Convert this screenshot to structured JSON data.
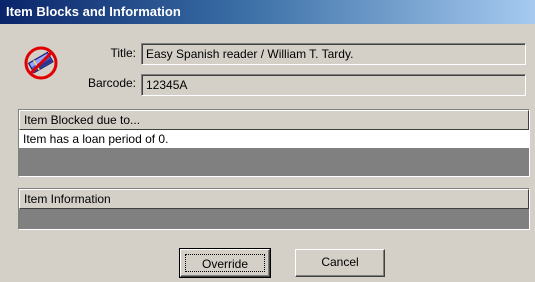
{
  "window": {
    "title": "Item Blocks and Information"
  },
  "icon": {
    "name": "item-blocked-icon"
  },
  "fields": {
    "title_label": "Title:",
    "title_value": "Easy Spanish reader / William T. Tardy.",
    "barcode_label": "Barcode:",
    "barcode_value": "12345A"
  },
  "blocked_panel": {
    "header": "Item Blocked due to...",
    "items": [
      "Item has a loan period of 0."
    ]
  },
  "info_panel": {
    "header": "Item Information"
  },
  "buttons": {
    "override": "Override",
    "cancel": "Cancel"
  }
}
